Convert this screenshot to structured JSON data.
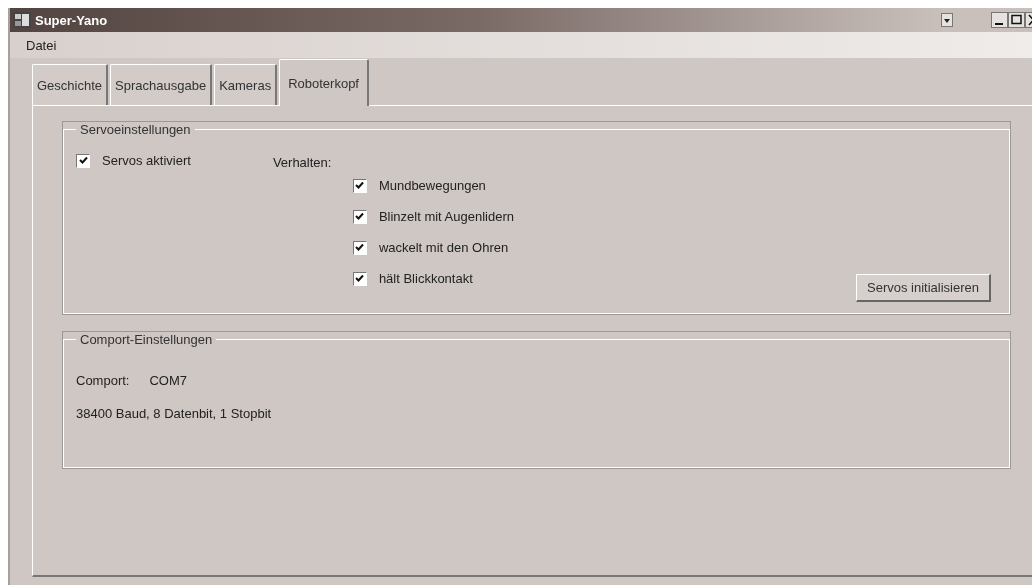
{
  "window": {
    "title": "Super-Yano"
  },
  "menu": [
    "Datei"
  ],
  "tabs": [
    {
      "label": "Geschichte",
      "selected": false
    },
    {
      "label": "Sprachausgabe",
      "selected": false
    },
    {
      "label": "Kameras",
      "selected": false
    },
    {
      "label": "Roboterkopf",
      "selected": true
    }
  ],
  "servo_group": {
    "title": "Servoeinstellungen",
    "enable": {
      "label": "Servos aktiviert",
      "checked": true
    },
    "behavior_label": "Verhalten:",
    "behaviors": [
      {
        "label": "Mundbewegungen",
        "checked": true
      },
      {
        "label": "Blinzelt mit Augenlidern",
        "checked": true
      },
      {
        "label": "wackelt mit den Ohren",
        "checked": true
      },
      {
        "label": "hält Blickkontakt",
        "checked": true
      }
    ],
    "button": "Servos initialisieren"
  },
  "comport_group": {
    "title": "Comport-Einstellungen",
    "port_label": "Comport:",
    "port_value": "COM7",
    "settings": "38400 Baud, 8 Datenbit, 1 Stopbit"
  }
}
